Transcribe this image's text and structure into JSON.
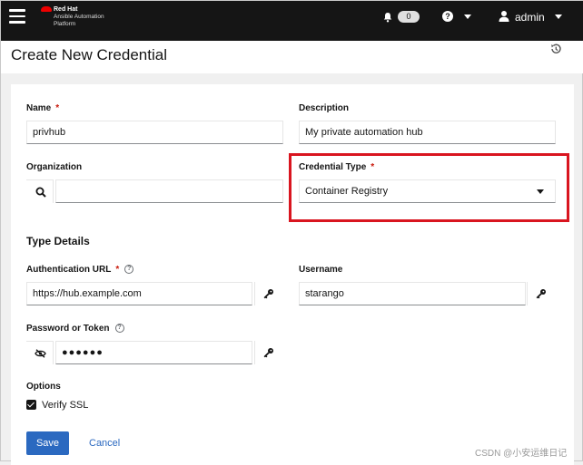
{
  "header": {
    "brand_line1": "Red Hat",
    "brand_line2": "Ansible Automation",
    "brand_line3": "Platform",
    "notifications_count": "0",
    "help_label": "?",
    "user_name": "admin"
  },
  "page": {
    "title": "Create New Credential"
  },
  "form": {
    "name_label": "Name",
    "name_value": "privhub",
    "description_label": "Description",
    "description_value": "My private automation hub",
    "organization_label": "Organization",
    "organization_value": "",
    "credential_type_label": "Credential Type",
    "credential_type_value": "Container Registry",
    "required_marker": "*",
    "type_details_title": "Type Details",
    "auth_url_label": "Authentication URL",
    "auth_url_value": "https://hub.example.com",
    "username_label": "Username",
    "username_value": "starango",
    "password_label": "Password or Token",
    "password_value": "●●●●●●",
    "options_label": "Options",
    "verify_ssl_label": "Verify SSL",
    "verify_ssl_checked": true,
    "help_glyph": "?"
  },
  "actions": {
    "save_label": "Save",
    "cancel_label": "Cancel"
  },
  "watermark": "CSDN @小安运维日记",
  "colors": {
    "topbar": "#151515",
    "primary": "#2b69c0",
    "required": "#c9190b",
    "highlight": "#d9151f"
  }
}
